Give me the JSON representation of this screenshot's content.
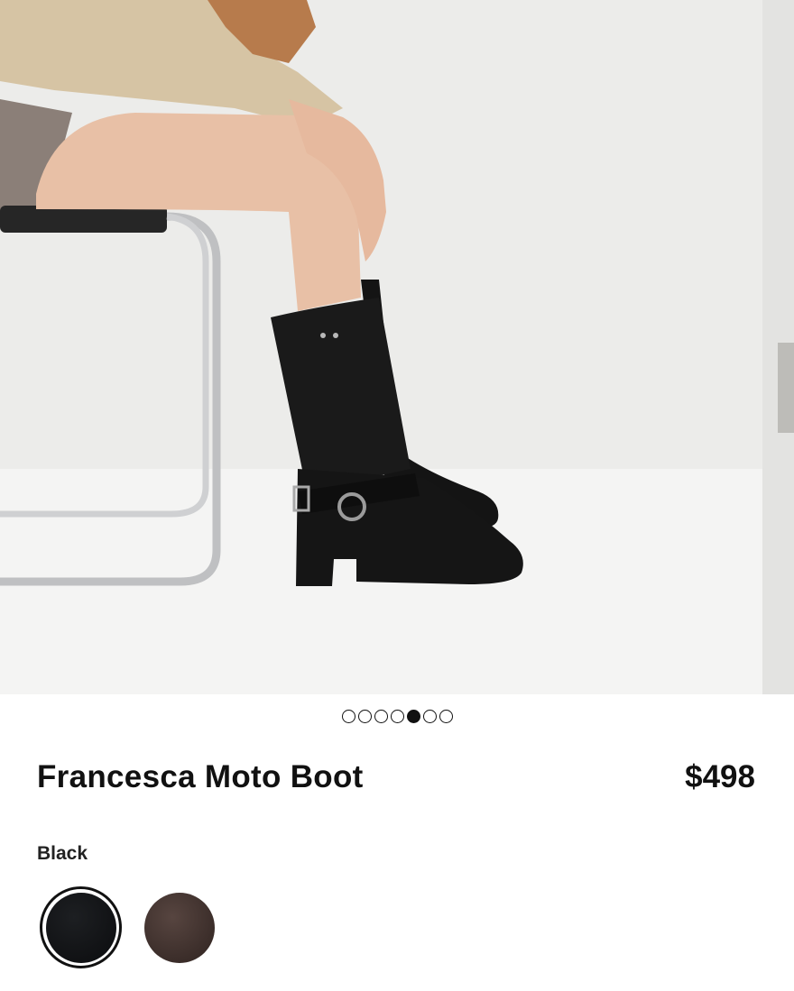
{
  "product": {
    "name": "Francesca Moto Boot",
    "price": "$498",
    "color_label": "Black"
  },
  "carousel": {
    "total": 7,
    "active_index": 4
  },
  "swatches": [
    {
      "name": "Black",
      "color": "#111214",
      "selected": true
    },
    {
      "name": "Brown",
      "color": "#3e2e2a",
      "selected": false
    }
  ]
}
